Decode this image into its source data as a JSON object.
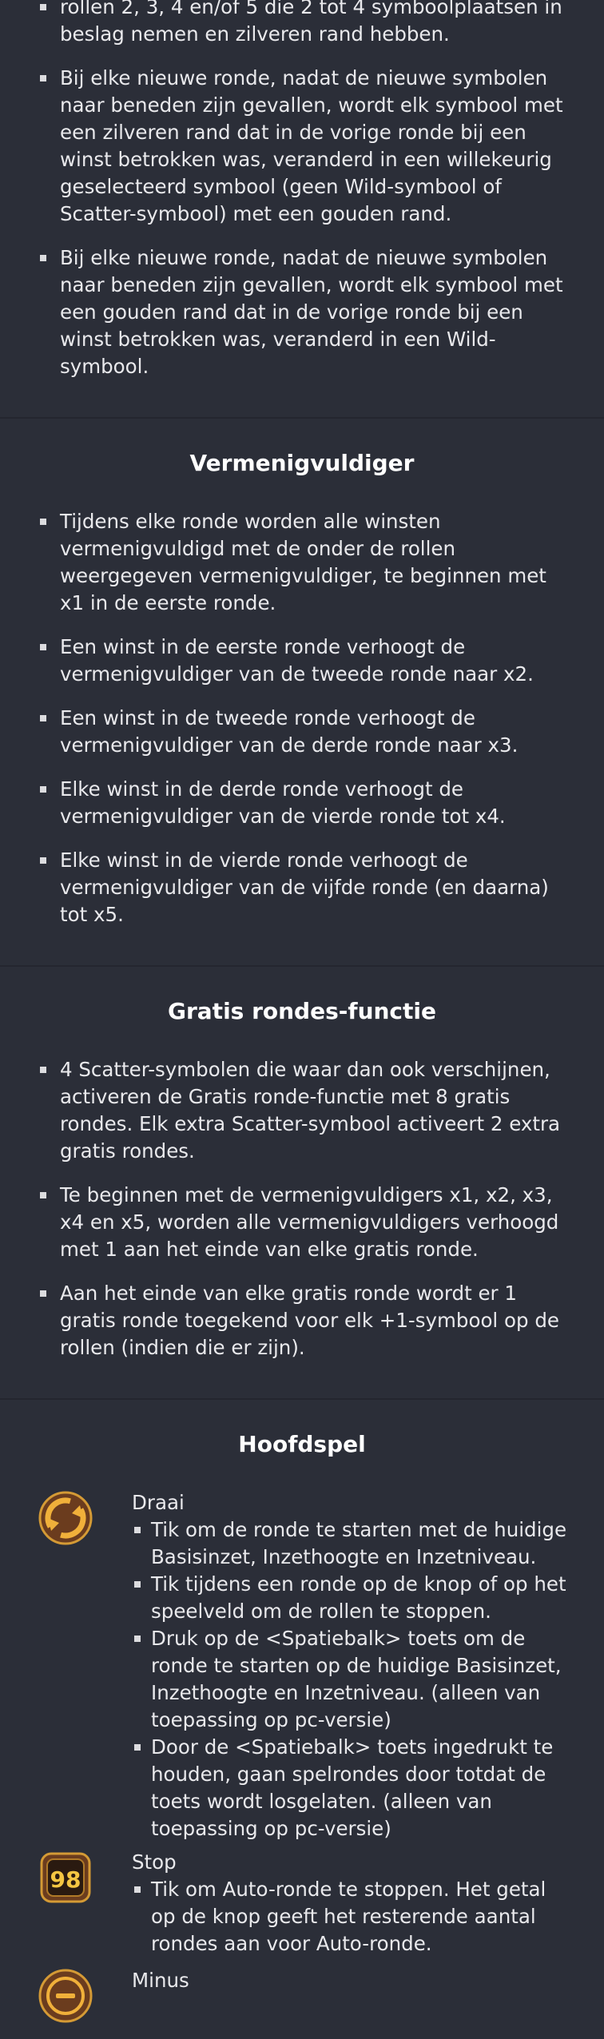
{
  "symbol_rules": {
    "items": [
      "rollen 2, 3, 4 en/of 5 die 2 tot 4 symboolplaatsen in beslag nemen en zilveren rand hebben.",
      "Bij elke nieuwe ronde, nadat de nieuwe symbolen naar beneden zijn gevallen, wordt elk symbool met een zilveren rand dat in de vorige ronde bij een winst betrokken was, veranderd in een willekeurig geselecteerd symbool (geen Wild-symbool of Scatter-symbool) met een gouden rand.",
      "Bij elke nieuwe ronde, nadat de nieuwe symbolen naar beneden zijn gevallen, wordt elk symbool met een gouden rand dat in de vorige ronde bij een winst betrokken was, veranderd in een Wild-symbool."
    ]
  },
  "multiplier": {
    "title": "Vermenigvuldiger",
    "items": [
      "Tijdens elke ronde worden alle winsten vermenigvuldigd met de onder de rollen weergegeven vermenigvuldiger, te beginnen met x1 in de eerste ronde.",
      "Een winst in de eerste ronde verhoogt de vermenigvuldiger van de tweede ronde naar x2.",
      "Een winst in de tweede ronde verhoogt de vermenigvuldiger van de derde ronde naar x3.",
      "Elke winst in de derde ronde verhoogt de vermenigvuldiger van de vierde ronde tot x4.",
      "Elke winst in de vierde ronde verhoogt de vermenigvuldiger van de vijfde ronde (en daarna) tot x5."
    ]
  },
  "free_spins": {
    "title": "Gratis rondes-functie",
    "items": [
      "4 Scatter-symbolen die waar dan ook verschijnen, activeren de Gratis ronde-functie met 8 gratis rondes. Elk extra Scatter-symbool activeert 2 extra gratis rondes.",
      "Te beginnen met de vermenigvuldigers x1, x2, x3, x4 en x5, worden alle vermenigvuldigers verhoogd met 1 aan het einde van elke gratis ronde.",
      "Aan het einde van elke gratis ronde wordt er 1 gratis ronde toegekend voor elk +1-symbool op de rollen (indien die er zijn)."
    ]
  },
  "main_game": {
    "title": "Hoofdspel",
    "spin": {
      "icon": "spin-icon",
      "label": "Draai",
      "items": [
        "Tik om de ronde te starten met de huidige Basisinzet, Inzethoogte en Inzetniveau.",
        "Tik tijdens een ronde op de knop of op het speelveld om de rollen te stoppen.",
        "Druk op de <Spatiebalk> toets om de ronde te starten op de huidige Basisinzet, Inzethoogte en Inzetniveau. (alleen van toepassing op pc-versie)",
        "Door de <Spatiebalk> toets ingedrukt te houden, gaan spelrondes door totdat de toets wordt losgelaten. (alleen van toepassing op pc-versie)"
      ]
    },
    "stop": {
      "icon": "autospin-stop-icon",
      "icon_text": "98",
      "label": "Stop",
      "items": [
        "Tik om Auto-ronde te stoppen. Het getal op de knop geeft het resterende aantal rondes aan voor Auto-ronde."
      ]
    },
    "minus": {
      "icon": "minus-icon",
      "label": "Minus"
    }
  },
  "colors": {
    "background": "#2b2e38",
    "text": "#e9e9ec",
    "icon_gold": "#c48a2a",
    "icon_brown": "#6b3c1e"
  }
}
